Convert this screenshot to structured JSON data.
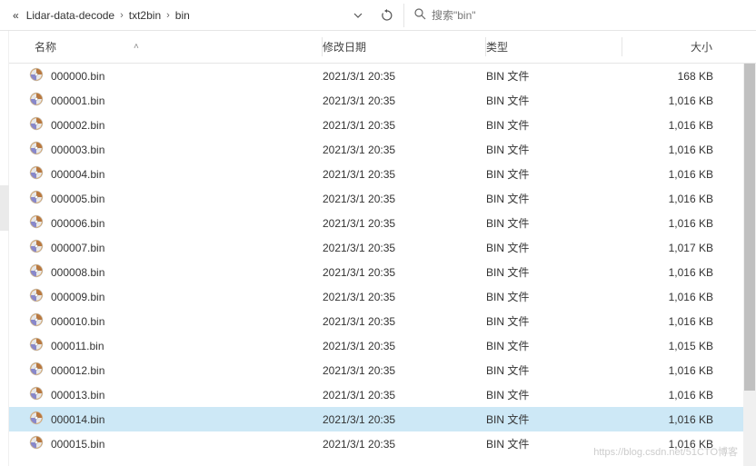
{
  "breadcrumb": {
    "prefix": "«",
    "items": [
      "Lidar-data-decode",
      "txt2bin",
      "bin"
    ]
  },
  "search": {
    "placeholder": "搜索\"bin\""
  },
  "columns": {
    "name": "名称",
    "date": "修改日期",
    "type": "类型",
    "size": "大小"
  },
  "files": [
    {
      "name": "000000.bin",
      "date": "2021/3/1 20:35",
      "type": "BIN 文件",
      "size": "168 KB",
      "selected": false
    },
    {
      "name": "000001.bin",
      "date": "2021/3/1 20:35",
      "type": "BIN 文件",
      "size": "1,016 KB",
      "selected": false
    },
    {
      "name": "000002.bin",
      "date": "2021/3/1 20:35",
      "type": "BIN 文件",
      "size": "1,016 KB",
      "selected": false
    },
    {
      "name": "000003.bin",
      "date": "2021/3/1 20:35",
      "type": "BIN 文件",
      "size": "1,016 KB",
      "selected": false
    },
    {
      "name": "000004.bin",
      "date": "2021/3/1 20:35",
      "type": "BIN 文件",
      "size": "1,016 KB",
      "selected": false
    },
    {
      "name": "000005.bin",
      "date": "2021/3/1 20:35",
      "type": "BIN 文件",
      "size": "1,016 KB",
      "selected": false
    },
    {
      "name": "000006.bin",
      "date": "2021/3/1 20:35",
      "type": "BIN 文件",
      "size": "1,016 KB",
      "selected": false
    },
    {
      "name": "000007.bin",
      "date": "2021/3/1 20:35",
      "type": "BIN 文件",
      "size": "1,017 KB",
      "selected": false
    },
    {
      "name": "000008.bin",
      "date": "2021/3/1 20:35",
      "type": "BIN 文件",
      "size": "1,016 KB",
      "selected": false
    },
    {
      "name": "000009.bin",
      "date": "2021/3/1 20:35",
      "type": "BIN 文件",
      "size": "1,016 KB",
      "selected": false
    },
    {
      "name": "000010.bin",
      "date": "2021/3/1 20:35",
      "type": "BIN 文件",
      "size": "1,016 KB",
      "selected": false
    },
    {
      "name": "000011.bin",
      "date": "2021/3/1 20:35",
      "type": "BIN 文件",
      "size": "1,015 KB",
      "selected": false
    },
    {
      "name": "000012.bin",
      "date": "2021/3/1 20:35",
      "type": "BIN 文件",
      "size": "1,016 KB",
      "selected": false
    },
    {
      "name": "000013.bin",
      "date": "2021/3/1 20:35",
      "type": "BIN 文件",
      "size": "1,016 KB",
      "selected": false
    },
    {
      "name": "000014.bin",
      "date": "2021/3/1 20:35",
      "type": "BIN 文件",
      "size": "1,016 KB",
      "selected": true
    },
    {
      "name": "000015.bin",
      "date": "2021/3/1 20:35",
      "type": "BIN 文件",
      "size": "1,016 KB",
      "selected": false
    }
  ],
  "watermark": "https://blog.csdn.net/51CTO博客"
}
